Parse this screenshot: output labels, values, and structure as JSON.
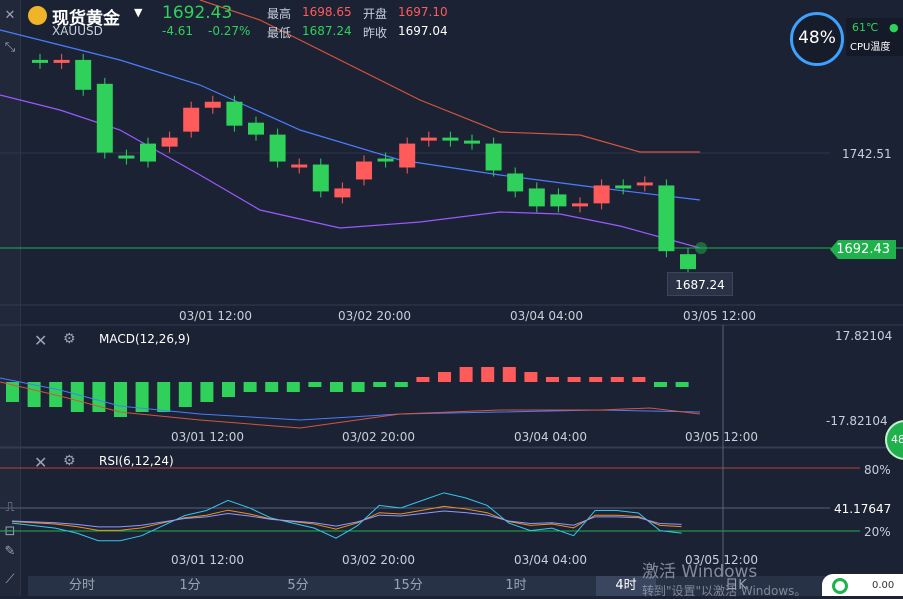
{
  "header": {
    "name": "现货黄金",
    "code": "XAUUSD",
    "price": "1692.43",
    "change": "-4.61",
    "change_pct": "-0.27%",
    "high_label": "最高",
    "high": "1698.65",
    "open_label": "开盘",
    "open": "1697.10",
    "low_label": "最低",
    "low": "1687.24",
    "prev_label": "昨收",
    "prev": "1697.04"
  },
  "cpu": {
    "percent": "48%",
    "temp": "61℃",
    "label": "CPU温度"
  },
  "main_chart": {
    "level_label": "1742.51",
    "current_price": "1692.43",
    "low_marker": "1687.24",
    "time_labels": [
      "03/01 12:00",
      "03/02 20:00",
      "03/04 04:00",
      "03/05 12:00"
    ]
  },
  "macd": {
    "title": "MACD(12,26,9)",
    "top_value": "17.82104",
    "bottom_value": "-17.82104",
    "time_labels": [
      "03/01 12:00",
      "03/02 20:00",
      "03/04 04:00",
      "03/05 12:00"
    ]
  },
  "rsi": {
    "title": "RSI(6,12,24)",
    "upper_level": "80%",
    "current": "41.17647",
    "lower_level": "20%",
    "time_labels": [
      "03/01 12:00",
      "03/02 20:00",
      "03/04 04:00",
      "03/05 12:00"
    ]
  },
  "side_badge": "48",
  "tabs": [
    "分时",
    "1分",
    "5分",
    "15分",
    "1时",
    "4时",
    "日K"
  ],
  "watermark": {
    "line1": "激活 Windows",
    "line2": "转到\"设置\"以激活 Windows。"
  },
  "corner_value": "0.00",
  "colors": {
    "up": "#ff5b5b",
    "down": "#2fd15a",
    "bg": "#1b2233",
    "ma_blue": "#4a7dff",
    "ma_red": "#d2553f",
    "ma_purple": "#9b59ff"
  },
  "chart_data": {
    "type": "candlestick",
    "candles": [
      {
        "o": 1762,
        "c": 1761
      },
      {
        "o": 1761,
        "c": 1762
      },
      {
        "o": 1762,
        "c": 1752
      },
      {
        "o": 1754,
        "c": 1731
      },
      {
        "o": 1730,
        "c": 1729
      },
      {
        "o": 1734,
        "c": 1728
      },
      {
        "o": 1733,
        "c": 1736
      },
      {
        "o": 1738,
        "c": 1746
      },
      {
        "o": 1746,
        "c": 1748
      },
      {
        "o": 1748,
        "c": 1740
      },
      {
        "o": 1741,
        "c": 1737
      },
      {
        "o": 1737,
        "c": 1728
      },
      {
        "o": 1726,
        "c": 1727
      },
      {
        "o": 1727,
        "c": 1718
      },
      {
        "o": 1716,
        "c": 1719
      },
      {
        "o": 1722,
        "c": 1728
      },
      {
        "o": 1729,
        "c": 1728
      },
      {
        "o": 1726,
        "c": 1734
      },
      {
        "o": 1735,
        "c": 1736
      },
      {
        "o": 1736,
        "c": 1735
      },
      {
        "o": 1735,
        "c": 1734
      },
      {
        "o": 1734,
        "c": 1725
      },
      {
        "o": 1724,
        "c": 1718
      },
      {
        "o": 1719,
        "c": 1713
      },
      {
        "o": 1717,
        "c": 1713
      },
      {
        "o": 1713,
        "c": 1714
      },
      {
        "o": 1714,
        "c": 1720
      },
      {
        "o": 1720,
        "c": 1719
      },
      {
        "o": 1720,
        "c": 1721
      },
      {
        "o": 1720,
        "c": 1698
      },
      {
        "o": 1697,
        "c": 1692
      }
    ],
    "macd_hist": [
      -4,
      -5,
      -5,
      -6,
      -6,
      -7,
      -6,
      -6,
      -5,
      -4,
      -3,
      -2,
      -2,
      -2,
      -1,
      -2,
      -2,
      -1,
      -1,
      1,
      2,
      3,
      3,
      3,
      2,
      1,
      1,
      1,
      1,
      1,
      -1,
      -1
    ],
    "rsi6": [
      42,
      40,
      38,
      34,
      28,
      28,
      32,
      40,
      48,
      52,
      60,
      54,
      46,
      42,
      38,
      30,
      40,
      56,
      54,
      60,
      66,
      62,
      56,
      42,
      36,
      38,
      32,
      52,
      52,
      50,
      36,
      34
    ],
    "rsi_range": [
      0,
      100
    ]
  }
}
